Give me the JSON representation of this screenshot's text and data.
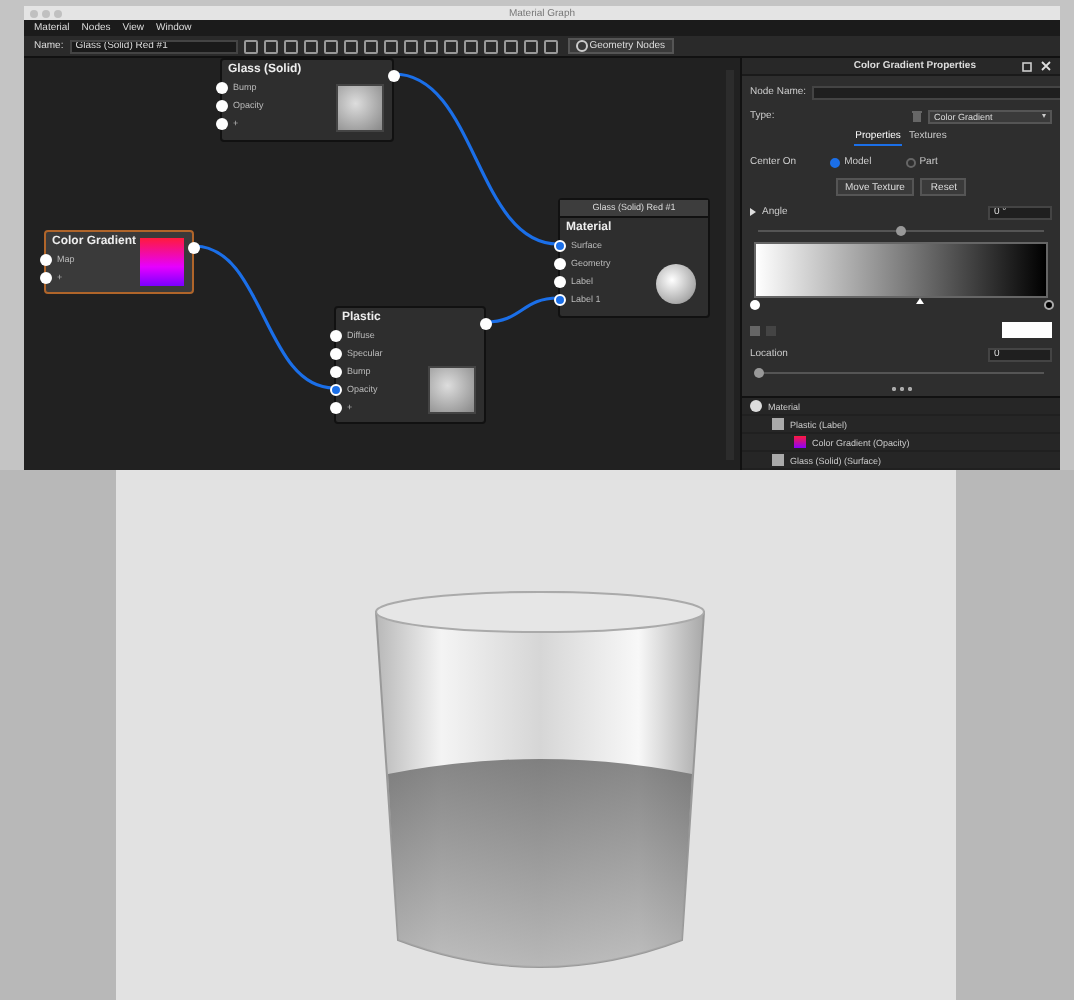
{
  "window": {
    "title": "Material Graph"
  },
  "menu": [
    "Material",
    "Nodes",
    "View",
    "Window"
  ],
  "toolbar": {
    "name_label": "Name:",
    "name_value": "Glass (Solid) Red #1",
    "geometry_button": "Geometry Nodes"
  },
  "nodes": [
    {
      "title": "Glass (Solid)",
      "selected": false,
      "kind": "texture",
      "ports": [
        {
          "label": "Bump",
          "connected": false
        },
        {
          "label": "Opacity",
          "connected": false
        },
        {
          "label": "+",
          "connected": false
        }
      ]
    },
    {
      "title": "Color Gradient",
      "selected": true,
      "kind": "gradient",
      "ports": [
        {
          "label": "Map",
          "connected": false
        },
        {
          "label": "+",
          "connected": false
        }
      ]
    },
    {
      "title": "Plastic",
      "selected": false,
      "kind": "texture",
      "ports": [
        {
          "label": "Diffuse",
          "connected": false
        },
        {
          "label": "Specular",
          "connected": false
        },
        {
          "label": "Bump",
          "connected": false
        },
        {
          "label": "Opacity",
          "connected": true
        },
        {
          "label": "+",
          "connected": false
        }
      ]
    },
    {
      "caption": "Glass (Solid) Red #1",
      "title": "Material",
      "selected": false,
      "kind": "sphere",
      "ports": [
        {
          "label": "Surface",
          "connected": true
        },
        {
          "label": "Geometry",
          "connected": false
        },
        {
          "label": "Label",
          "connected": false
        },
        {
          "label": "Label 1",
          "connected": true
        }
      ]
    }
  ],
  "properties": {
    "title": "Color Gradient Properties",
    "node_name_label": "Node Name:",
    "type_label": "Type:",
    "type_value": "Color Gradient",
    "tabs": [
      {
        "label": "Properties",
        "selected": true
      },
      {
        "label": "Textures",
        "selected": false
      }
    ],
    "center_on_label": "Center On",
    "radios": [
      {
        "label": "Model",
        "selected": true
      },
      {
        "label": "Part",
        "selected": false
      }
    ],
    "buttons": [
      "Move Texture",
      "Reset"
    ],
    "angle": {
      "label": "Angle",
      "value": "0 °",
      "level": 0.5
    },
    "location": {
      "label": "Location",
      "value": "0",
      "level": 0
    },
    "tree": [
      {
        "label": "Material",
        "children": [
          {
            "label": "Plastic (Label)",
            "children": [
              {
                "label": "Color Gradient (Opacity)"
              }
            ]
          },
          {
            "label": "Glass (Solid) (Surface)"
          }
        ]
      }
    ]
  }
}
